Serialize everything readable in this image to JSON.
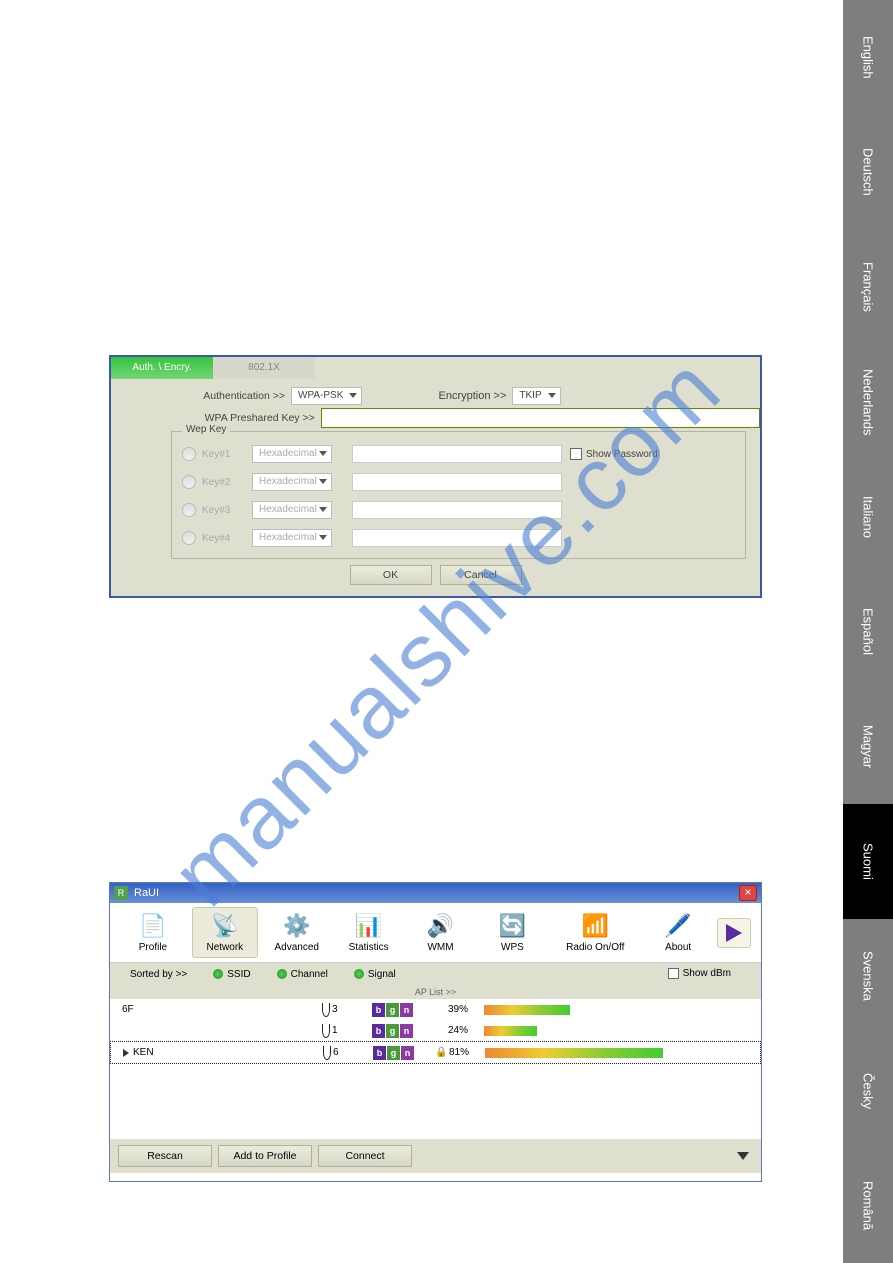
{
  "watermark": "manualshive.com",
  "languages": [
    "English",
    "Deutsch",
    "Français",
    "Nederlands",
    "Italiano",
    "Español",
    "Magyar",
    "Suomi",
    "Svenska",
    "Česky",
    "Română"
  ],
  "active_language_index": 7,
  "auth_panel": {
    "tab_active": "Auth. \\ Encry.",
    "tab_inactive": "802.1X",
    "authentication_label": "Authentication >>",
    "authentication_value": "WPA-PSK",
    "encryption_label": "Encryption >>",
    "encryption_value": "TKIP",
    "preshared_label": "WPA Preshared Key >>",
    "preshared_value": "",
    "wep_legend": "Wep Key",
    "keys": [
      {
        "label": "Key#1",
        "mode": "Hexadecimal"
      },
      {
        "label": "Key#2",
        "mode": "Hexadecimal"
      },
      {
        "label": "Key#3",
        "mode": "Hexadecimal"
      },
      {
        "label": "Key#4",
        "mode": "Hexadecimal"
      }
    ],
    "show_password": "Show Password",
    "ok": "OK",
    "cancel": "Cancel"
  },
  "raui": {
    "title": "RaUI",
    "toolbar": [
      {
        "label": "Profile"
      },
      {
        "label": "Network"
      },
      {
        "label": "Advanced"
      },
      {
        "label": "Statistics"
      },
      {
        "label": "WMM"
      },
      {
        "label": "WPS"
      },
      {
        "label": "Radio On/Off"
      },
      {
        "label": "About"
      }
    ],
    "sorted_by": "Sorted by >>",
    "sort_ssid": "SSID",
    "sort_channel": "Channel",
    "sort_signal": "Signal",
    "show_dbm": "Show dBm",
    "aplist_header": "AP List >>",
    "rows": [
      {
        "ssid": "6F",
        "ch": "3",
        "locked": false,
        "pct": "39%",
        "sig": 39,
        "selected": false
      },
      {
        "ssid": "",
        "ch": "1",
        "locked": false,
        "pct": "24%",
        "sig": 24,
        "selected": false
      },
      {
        "ssid": "KEN",
        "ch": "6",
        "locked": true,
        "pct": "81%",
        "sig": 81,
        "selected": true
      }
    ],
    "rescan": "Rescan",
    "add_profile": "Add to Profile",
    "connect": "Connect"
  }
}
